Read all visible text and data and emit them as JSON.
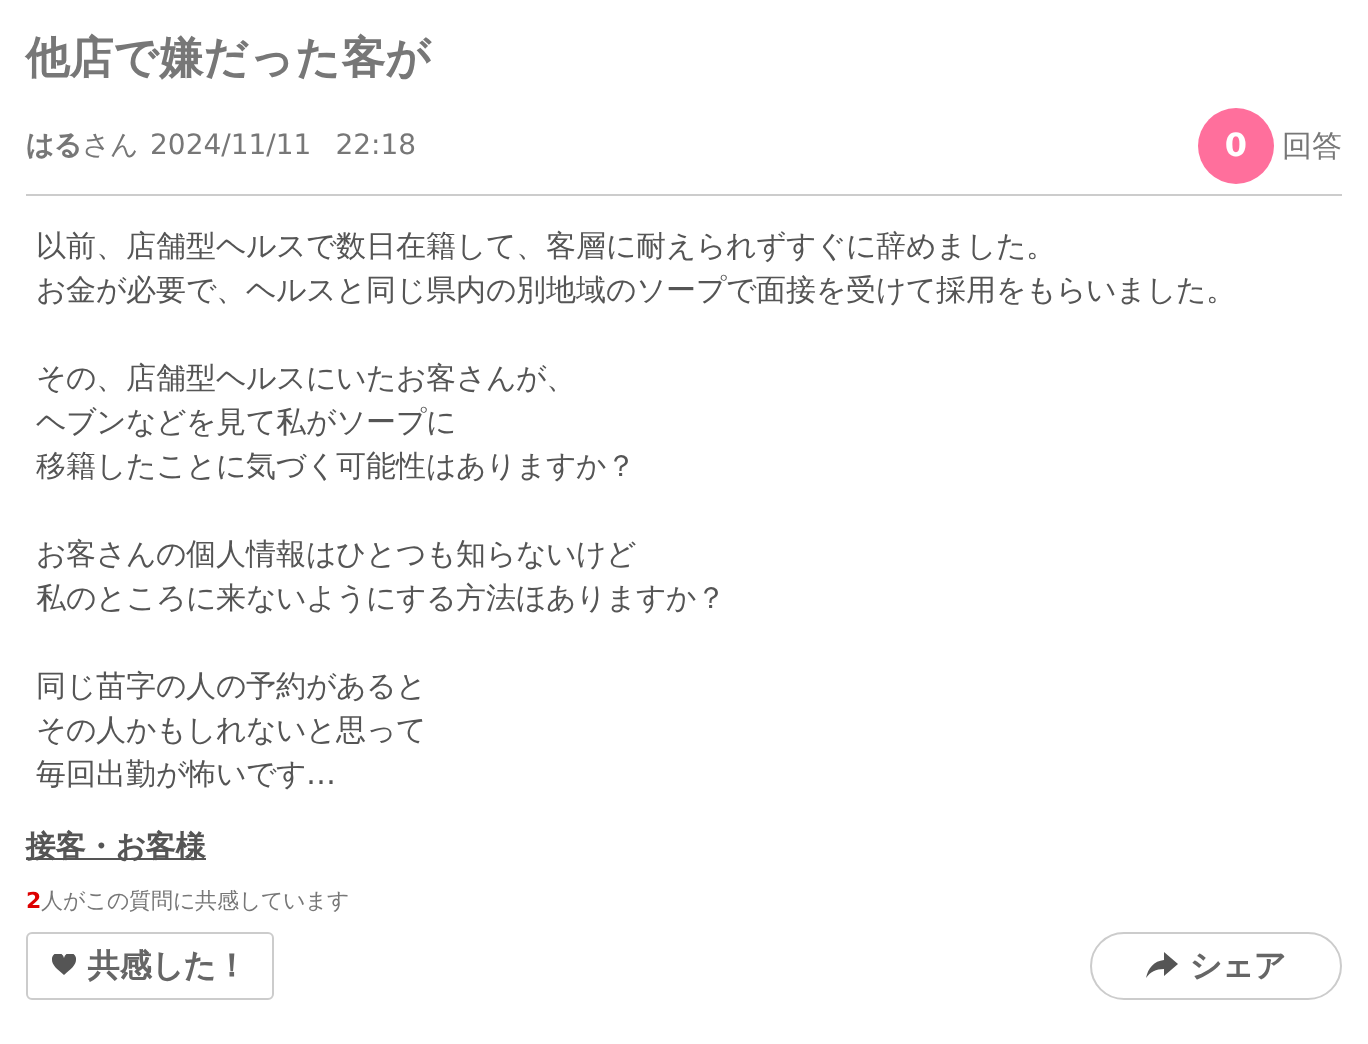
{
  "title": "他店で嫌だった客が",
  "author": {
    "name": "はる",
    "suffix": "さん",
    "date": "2024/11/11",
    "time": "22:18"
  },
  "answers": {
    "count": "0",
    "label": "回答"
  },
  "body": [
    [
      "以前、店舗型ヘルスで数日在籍して、客層に耐えられずすぐに辞めました。",
      "お金が必要で、ヘルスと同じ県内の別地域のソープで面接を受けて採用をもらいました。"
    ],
    [
      "その、店舗型ヘルスにいたお客さんが、",
      "ヘブンなどを見て私がソープに",
      "移籍したことに気づく可能性はありますか？"
    ],
    [
      "お客さんの個人情報はひとつも知らないけど",
      "私のところに来ないようにする方法ほありますか？"
    ],
    [
      "同じ苗字の人の予約があると",
      "その人かもしれないと思って",
      "毎回出勤が怖いです…"
    ]
  ],
  "category": "接客・お客様",
  "empathy": {
    "count": "2",
    "text": "人がこの質問に共感しています"
  },
  "buttons": {
    "empathize": "共感した！",
    "share": "シェア"
  }
}
